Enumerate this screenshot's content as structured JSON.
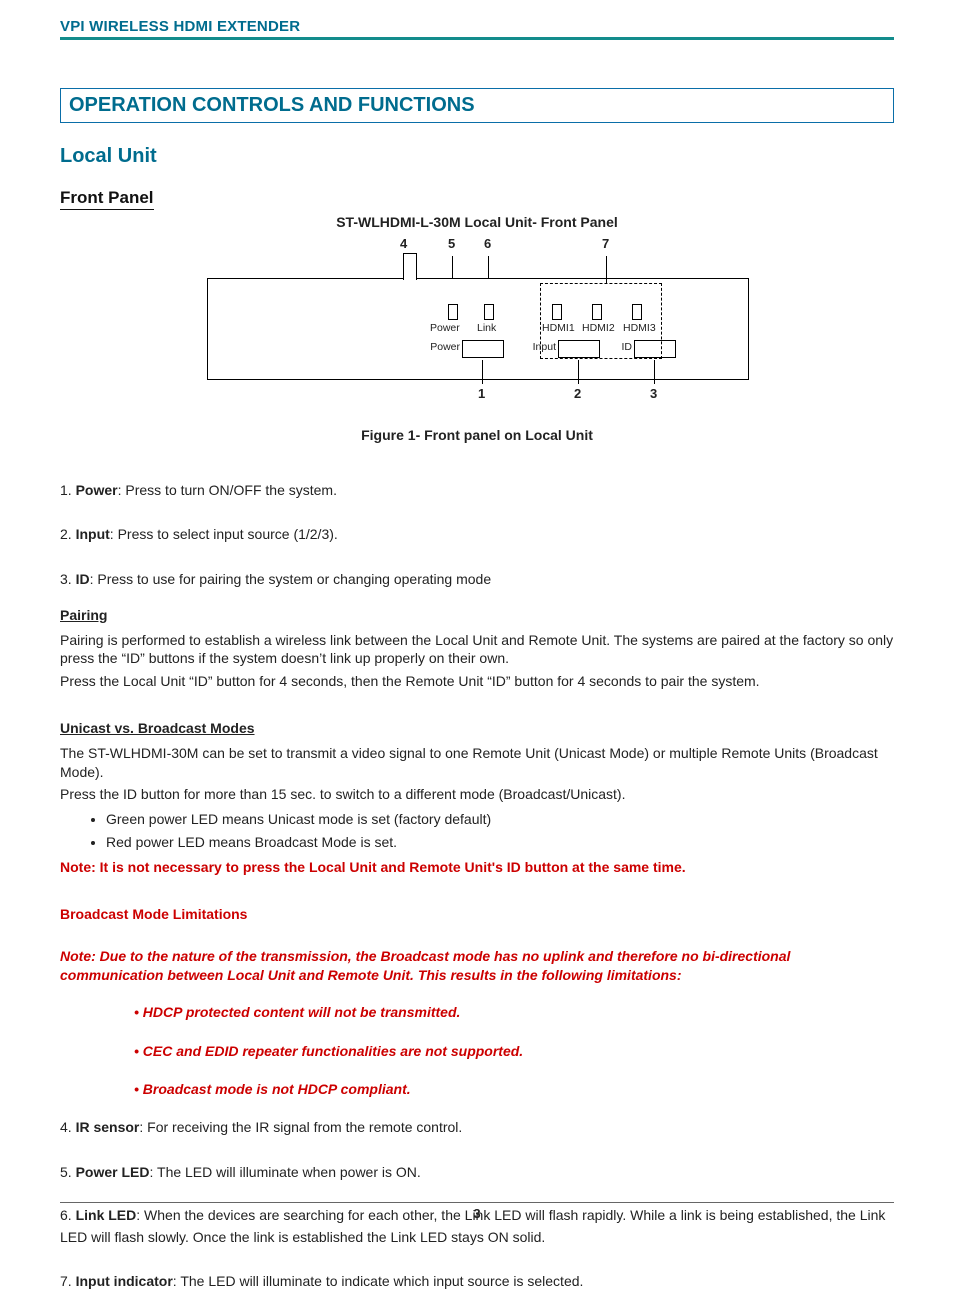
{
  "header": {
    "product": "VPI WIRELESS HDMI EXTENDER"
  },
  "section_title": "OPERATION CONTROLS AND FUNCTIONS",
  "subsection": "Local Unit",
  "panel_label": "Front Panel",
  "figure": {
    "title": "ST-WLHDMI-L-30M Local Unit- Front Panel",
    "caption": "Figure 1- Front panel on Local Unit",
    "top_nums": {
      "n4": "4",
      "n5": "5",
      "n6": "6",
      "n7": "7"
    },
    "bot_nums": {
      "n1": "1",
      "n2": "2",
      "n3": "3"
    },
    "led_labels": {
      "power": "Power",
      "link": "Link",
      "h1": "HDMI1",
      "h2": "HDMI2",
      "h3": "HDMI3"
    },
    "btn_labels": {
      "power": "Power",
      "input": "Input",
      "id": "ID"
    }
  },
  "items": {
    "i1": {
      "num": "1. ",
      "name": "Power",
      "text": ": Press to turn ON/OFF the system."
    },
    "i2": {
      "num": "2. ",
      "name": "Input",
      "text": ": Press to select input source (1/2/3)."
    },
    "i3": {
      "num": "3. ",
      "name": "ID",
      "text": ": Press to use for pairing the system or changing operating mode"
    },
    "i4": {
      "num": "4. ",
      "name": "IR sensor",
      "text": ": For receiving the IR signal from the remote control."
    },
    "i5": {
      "num": "5. ",
      "name": "Power LED",
      "text": ": The LED will illuminate when power is ON."
    },
    "i6": {
      "num": "6. ",
      "name": "Link LED",
      "text": ": When the devices are searching for each other, the Link LED will flash rapidly.  While a link is being established, the Link LED will flash slowly.  Once the link is established the Link LED stays ON solid."
    },
    "i7": {
      "num": "7. ",
      "name": "Input indicator",
      "text": ": The LED will illuminate to indicate which input source is selected."
    }
  },
  "pairing": {
    "heading": "Pairing",
    "p1": "Pairing is performed to establish a wireless link between the Local Unit and Remote Unit. The systems are paired at the factory so only press the “ID” buttons if the system doesn’t link up properly on their own.",
    "p2": "Press the Local Unit “ID” button for 4 seconds, then the Remote Unit “ID” button for 4 seconds to pair the system."
  },
  "modes": {
    "heading": "Unicast vs. Broadcast Modes",
    "p1": "The ST-WLHDMI-30M can be set to transmit a video signal to one Remote Unit  (Unicast Mode) or multiple Remote Units (Broadcast Mode).",
    "p2": "Press the ID button for more than 15 sec. to switch to a different mode (Broadcast/Unicast).",
    "b1": "Green power LED means Unicast mode is set (factory default)",
    "b2": "Red power LED means Broadcast Mode is set.",
    "note": "Note: It is not necessary to press the Local Unit and Remote Unit's ID button at the same time."
  },
  "broadcast": {
    "heading": "Broadcast Mode Limitations",
    "note": "Note: Due to the nature of the transmission, the Broadcast mode has no uplink and therefore no bi-directional communication between Local Unit and Remote Unit. This results in the following limitations:",
    "l1": "• HDCP protected content will not be transmitted.",
    "l2": "• CEC and EDID repeater functionalities are not supported.",
    "l3": "• Broadcast mode is not HDCP compliant."
  },
  "page_number": "3"
}
